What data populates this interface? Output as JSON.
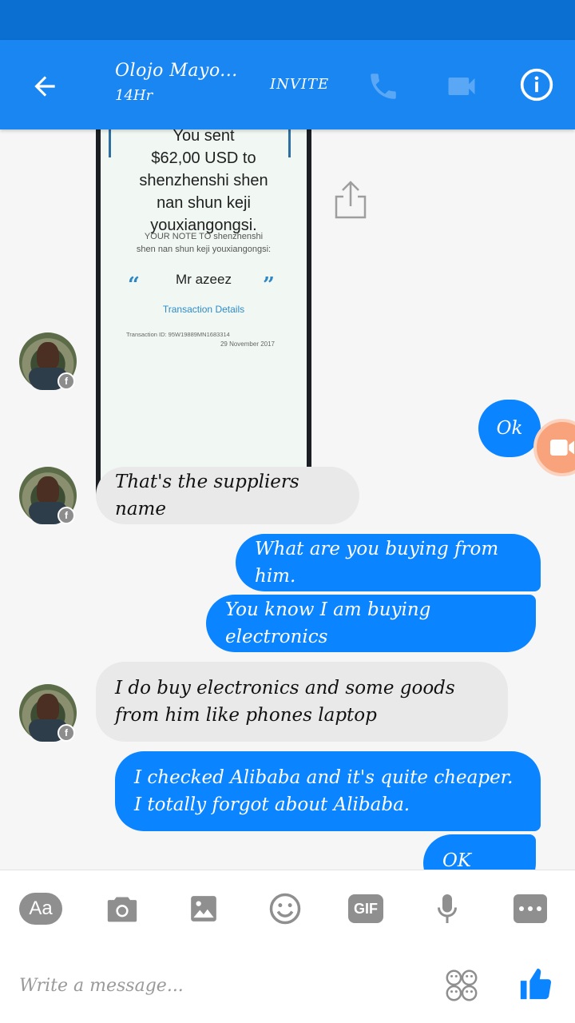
{
  "header": {
    "contact_name": "Olojo Mayo...",
    "status": "14Hr",
    "invite_label": "INVITE",
    "accent_color": "#1a86f2"
  },
  "receipt": {
    "sent_line1": "You sent",
    "sent_line2": "$62,00 USD to",
    "sent_line3": "shenzhenshi shen",
    "sent_line4": "nan shun keji",
    "sent_line5": "youxiangongsi.",
    "note_line1": "YOUR NOTE TO shenzhenshi",
    "note_line2": "shen nan shun keji youxiangongsi:",
    "memo": "Mr azeez",
    "details_link": "Transaction Details",
    "transaction_id": "Transaction ID: 95W19889MN1683314",
    "date": "29 November 2017"
  },
  "messages": [
    {
      "from": "me",
      "text": "Ok"
    },
    {
      "from": "them",
      "text": "That's the suppliers name"
    },
    {
      "from": "me",
      "text": "What are you buying from him."
    },
    {
      "from": "me",
      "text": "You know I am buying electronics"
    },
    {
      "from": "them",
      "text": "I do buy electronics and some goods from him like phones laptop"
    },
    {
      "from": "me",
      "text": "I checked Alibaba and it's quite cheaper. I totally forgot about Alibaba."
    },
    {
      "from": "me",
      "text": "OK then."
    }
  ],
  "composer": {
    "placeholder": "Write a message...",
    "tools": [
      "text-format-icon",
      "camera-icon",
      "image-icon",
      "emoji-icon",
      "gif-icon",
      "microphone-icon",
      "more-icon"
    ],
    "aa_label": "Aa",
    "gif_label": "GIF"
  }
}
